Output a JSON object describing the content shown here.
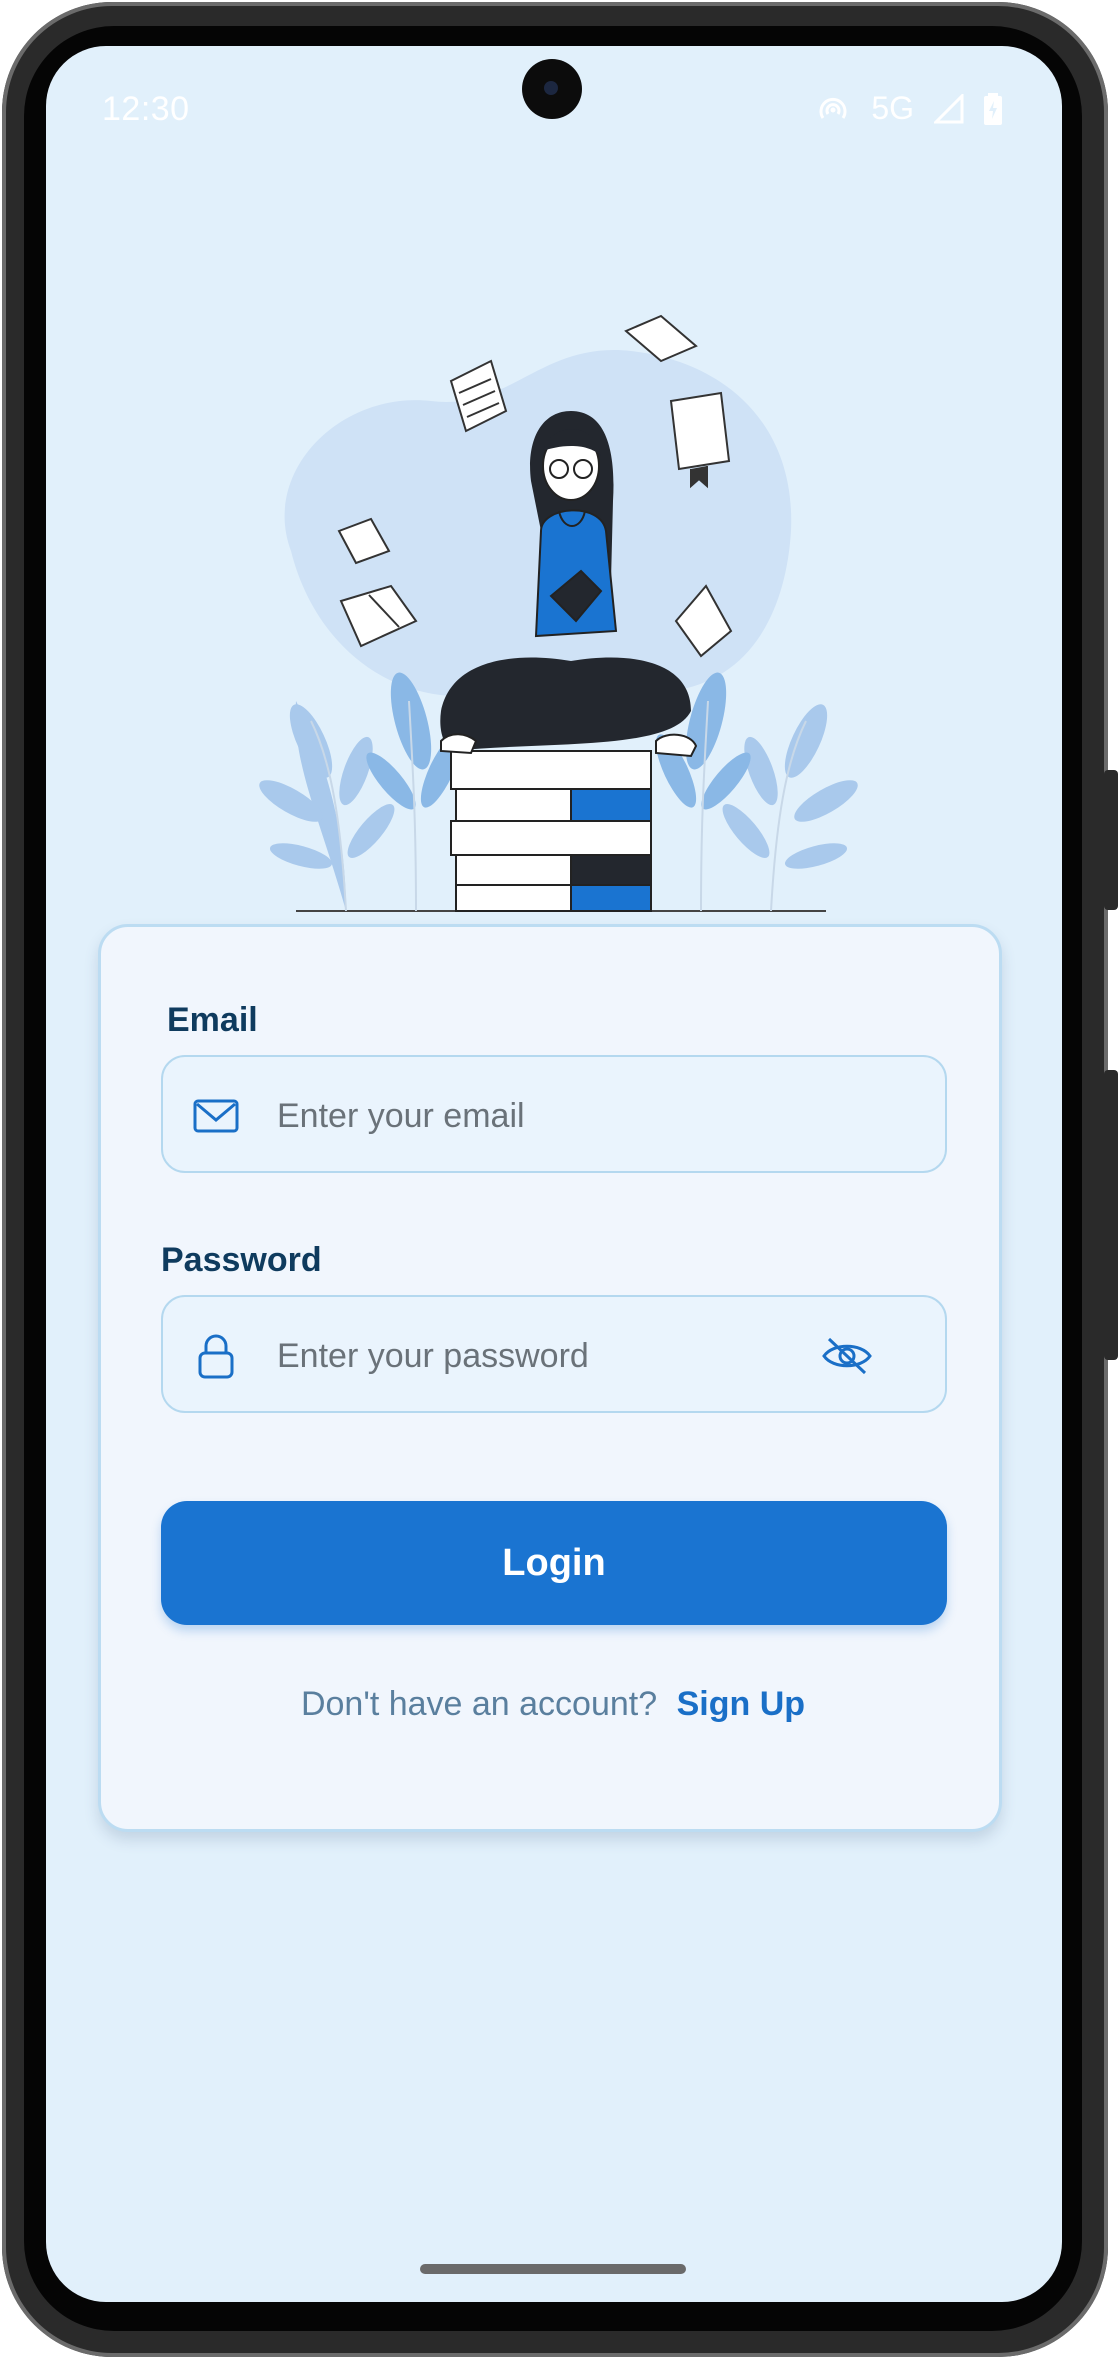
{
  "status_bar": {
    "time": "12:30",
    "network": "5G"
  },
  "illustration": {
    "subject": "woman reading a book on a stack of books with floating books and plants",
    "colors": {
      "accent": "#1a74d1",
      "blob": "#cfe2f6",
      "leaf": "#9cc3e9",
      "ink": "#23272e"
    }
  },
  "form": {
    "email_label": "Email",
    "email_placeholder": "Enter your email",
    "password_label": "Password",
    "password_placeholder": "Enter your password",
    "login_label": "Login",
    "signup_question": "Don't have an account?",
    "signup_link": "Sign Up"
  },
  "icons": {
    "email": "mail-icon",
    "password": "lock-icon",
    "visibility": "eye-off-icon"
  },
  "colors": {
    "background": "#e1f0fb",
    "primary": "#1a74d1",
    "label": "#0f3b5e",
    "muted": "#5a7f9e"
  }
}
